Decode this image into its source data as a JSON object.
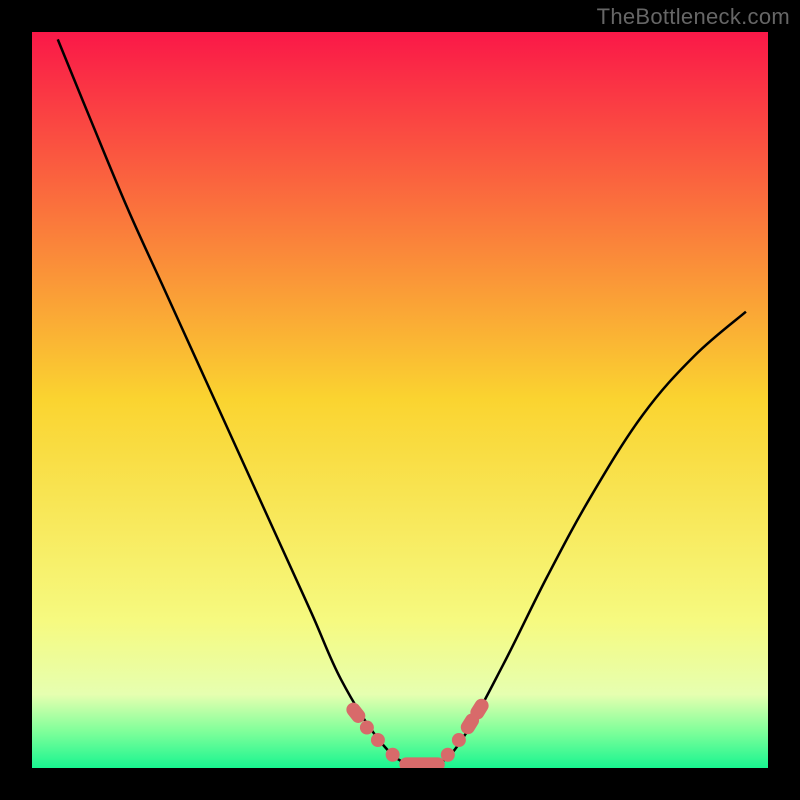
{
  "attribution": "TheBottleneck.com",
  "chart_data": {
    "type": "line",
    "title": "",
    "xlabel": "",
    "ylabel": "",
    "xlim": [
      0,
      1
    ],
    "ylim": [
      0,
      1
    ],
    "note": "Axes have no visible tick labels; values are normalized estimates read from pixel positions.",
    "background_gradient_stops": [
      {
        "pos": 0.0,
        "color": "#fa1848"
      },
      {
        "pos": 0.5,
        "color": "#fad430"
      },
      {
        "pos": 0.8,
        "color": "#f6fa80"
      },
      {
        "pos": 0.9,
        "color": "#e6ffb0"
      },
      {
        "pos": 0.95,
        "color": "#80ff9a"
      },
      {
        "pos": 1.0,
        "color": "#18f590"
      }
    ],
    "series": [
      {
        "name": "bottleneck-curve",
        "color": "#000000",
        "x": [
          0.035,
          0.08,
          0.13,
          0.18,
          0.23,
          0.28,
          0.33,
          0.38,
          0.42,
          0.47,
          0.51,
          0.55,
          0.585,
          0.64,
          0.7,
          0.76,
          0.83,
          0.9,
          0.97
        ],
        "y": [
          0.99,
          0.88,
          0.76,
          0.65,
          0.54,
          0.43,
          0.32,
          0.21,
          0.12,
          0.04,
          0.005,
          0.005,
          0.04,
          0.14,
          0.26,
          0.37,
          0.48,
          0.56,
          0.62
        ]
      },
      {
        "name": "bottom-markers",
        "type": "scatter",
        "color": "#d86a6a",
        "x": [
          0.44,
          0.455,
          0.47,
          0.49,
          0.51,
          0.53,
          0.55,
          0.565,
          0.58,
          0.595,
          0.608
        ],
        "y": [
          0.075,
          0.055,
          0.038,
          0.018,
          0.005,
          0.005,
          0.005,
          0.018,
          0.038,
          0.06,
          0.08
        ]
      }
    ]
  }
}
